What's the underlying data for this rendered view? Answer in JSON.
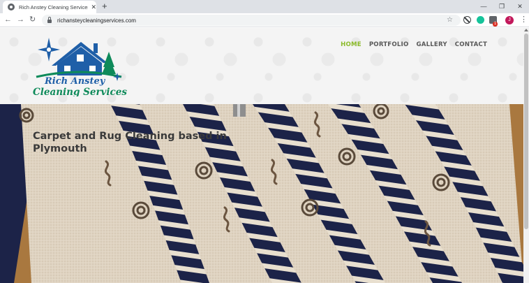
{
  "browser": {
    "tab_title": "Rich Anstey Cleaning Services in",
    "tab_close": "✕",
    "new_tab": "+",
    "window_minimize": "—",
    "window_restore": "❐",
    "window_close": "✕",
    "url": "richansteycleaningservices.com",
    "extension_badge_count": "1",
    "profile_initial": "J"
  },
  "site": {
    "logo_line1": "Rich Anstey",
    "logo_line2": "Cleaning Services",
    "nav": [
      "HOME",
      "PORTFOLIO",
      "GALLERY",
      "CONTACT"
    ],
    "active_nav": "HOME",
    "hero_title": "Carpet and Rug Cleaning based in Plymouth"
  },
  "colors": {
    "nav_active": "#8cbb2b",
    "nav_default": "#5a5a5a",
    "logo_blue": "#1f5fa8",
    "logo_green": "#0e8a5a",
    "carpet_cream": "#e2d7c6",
    "carpet_navy": "#1c2348",
    "carpet_border": "#a9783f"
  }
}
